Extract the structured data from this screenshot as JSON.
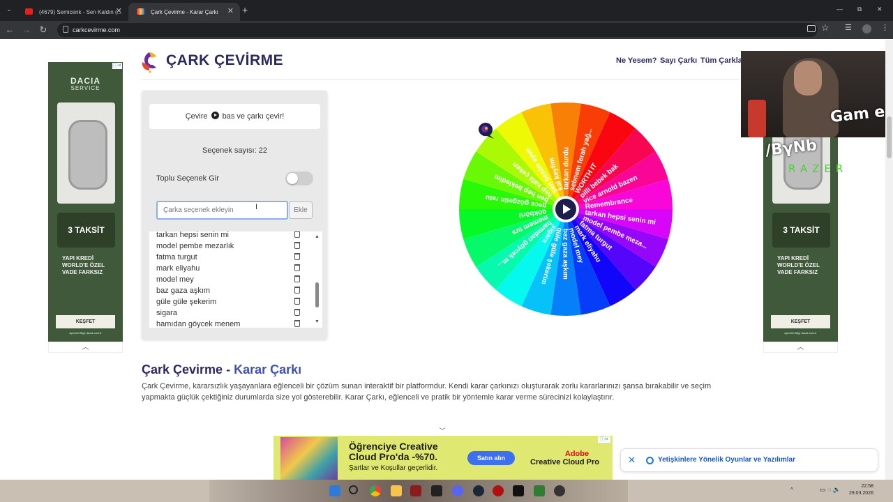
{
  "browser": {
    "tabs": [
      {
        "title": "(4679) Semicenk - Sen Kaldın (...",
        "active": false
      },
      {
        "title": "Çark Çevirme - Karar Çarkı",
        "active": true
      }
    ],
    "new_tab": "+",
    "url": "carkcevirme.com",
    "window_controls": [
      "—",
      "⧉",
      "✕"
    ]
  },
  "site": {
    "title": "ÇARK ÇEVİRME",
    "nav": [
      "Ne Yesem?",
      "Sayı Çarkı",
      "Tüm Çarklar"
    ]
  },
  "panel": {
    "hint_before": "Çevire",
    "hint_after": "bas ve çarkı çevir!",
    "count_label": "Seçenek sayısı: 22",
    "bulk_label": "Toplu Seçenek Gir",
    "bulk_enabled": false,
    "input_placeholder": "Çarka seçenek ekleyin",
    "add_button": "Ekle",
    "options": [
      "tarkan hepsi senin mi",
      "model pembe mezarlık",
      "fatma turgut",
      "mark eliyahu",
      "model mey",
      "baz gaza aşkım",
      "güle güle şekerim",
      "sigara",
      "hamıdan göycek menem"
    ]
  },
  "wheel": {
    "segments": [
      "tarkan durdu",
      "sebnem ferah yağ...",
      "WORTH IT",
      "pilli bebek bak",
      "vice arnold bazen",
      "Remembrance",
      "tarkan hepsi senin mi",
      "model pembe meza...",
      "fatma turgut",
      "mark eliyahu",
      "model mey",
      "baz gaza aşkım",
      "güle güle şekerim",
      "sigara",
      "hamıdan göycek m...",
      "memem tırs",
      "gökbörü",
      "gece gözgetin ratu",
      "ben hep bekledim",
      "hep kafa çeken",
      "sen benim ayım",
      "kal keyfim"
    ]
  },
  "article": {
    "heading_plain": "Çark Çevirme - ",
    "heading_accent": "Karar Çarkı",
    "body": "Çark Çevirme, kararsızlık yaşayanlara eğlenceli bir çözüm sunan interaktif bir platformdur. Kendi karar çarkınızı oluşturarak zorlu kararlarınızı şansa bırakabilir ve seçim yapmakta güçlük çektiğiniz durumlarda size yol gösterebilir. Karar Çarkı, eğlenceli ve pratik bir yöntemle karar verme sürecinizi kolaylaştırır."
  },
  "side_ad": {
    "brand": "DACIA",
    "brand_sub": "SERVICE",
    "headline": "3 TAKSİT",
    "body": "YAPI KREDİ WORLD'E ÖZEL VADE FARKSIZ",
    "cta": "KEŞFET",
    "fine": "Ayrıntılı Bilgi: dacia.com.tr"
  },
  "bottom_ad": {
    "headline": "Öğrenciye Creative Cloud Pro'da -%70.",
    "terms": "Şartlar ve Koşullar geçerlidir.",
    "cta": "Satın alın",
    "brand1": "Adobe",
    "brand2": "Creative Cloud Pro"
  },
  "notification": {
    "text": "Yetişkinlere Yönelik Oyunlar ve Yazılımlar",
    "close": "✕"
  },
  "stream_overlay": {
    "game_text": "Gam e",
    "name_text": "/BγNb",
    "razer_text": "RAZER"
  },
  "taskbar": {
    "time": "22:58",
    "date": "29.03.2026"
  },
  "colors": {
    "brand": "#2a2860",
    "accent": "#3f51b5",
    "wheel_hub": "#1e1e4a"
  }
}
